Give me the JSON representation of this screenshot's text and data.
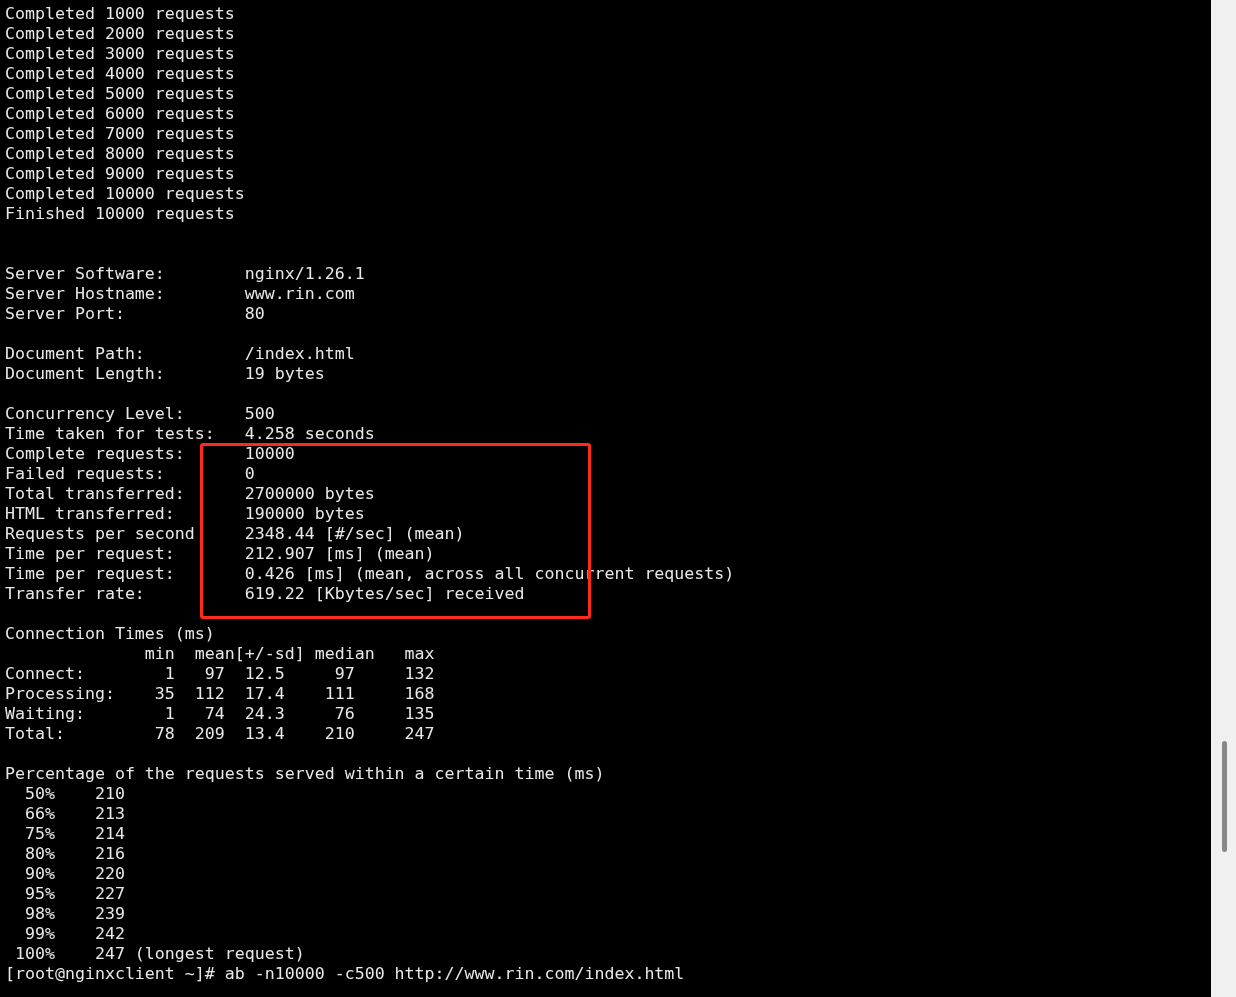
{
  "terminal": {
    "blocks": [
      {
        "kind": "progress",
        "lines": [
          "Completed 1000 requests",
          "Completed 2000 requests",
          "Completed 3000 requests",
          "Completed 4000 requests",
          "Completed 5000 requests",
          "Completed 6000 requests",
          "Completed 7000 requests",
          "Completed 8000 requests",
          "Completed 9000 requests",
          "Completed 10000 requests",
          "Finished 10000 requests"
        ]
      },
      {
        "kind": "section",
        "lines": [
          "Server Software:        nginx/1.26.1",
          "Server Hostname:        www.rin.com",
          "Server Port:            80"
        ]
      },
      {
        "kind": "section",
        "lines": [
          "Document Path:          /index.html",
          "Document Length:        19 bytes"
        ]
      },
      {
        "kind": "section",
        "lines": [
          "Concurrency Level:      500",
          "Time taken for tests:   4.258 seconds",
          "Complete requests:      10000",
          "Failed requests:        0",
          "Total transferred:      2700000 bytes",
          "HTML transferred:       190000 bytes",
          "Requests per second     2348.44 [#/sec] (mean)",
          "Time per request:       212.907 [ms] (mean)",
          "Time per request:       0.426 [ms] (mean, across all concurrent requests)",
          "Transfer rate:          619.22 [Kbytes/sec] received"
        ]
      },
      {
        "kind": "section",
        "lines": [
          "Connection Times (ms)",
          "              min  mean[+/-sd] median   max",
          "Connect:        1   97  12.5     97     132",
          "Processing:    35  112  17.4    111     168",
          "Waiting:        1   74  24.3     76     135",
          "Total:         78  209  13.4    210     247"
        ]
      },
      {
        "kind": "tail",
        "lines": [
          "Percentage of the requests served within a certain time (ms)",
          "  50%    210",
          "  66%    213",
          "  75%    214",
          "  80%    216",
          "  90%    220",
          "  95%    227",
          "  98%    239",
          "  99%    242",
          " 100%    247 (longest request)"
        ]
      }
    ],
    "prompt": "[root@nginxclient ~]# ab -n10000 -c500 http://www.rin.com/index.html"
  }
}
